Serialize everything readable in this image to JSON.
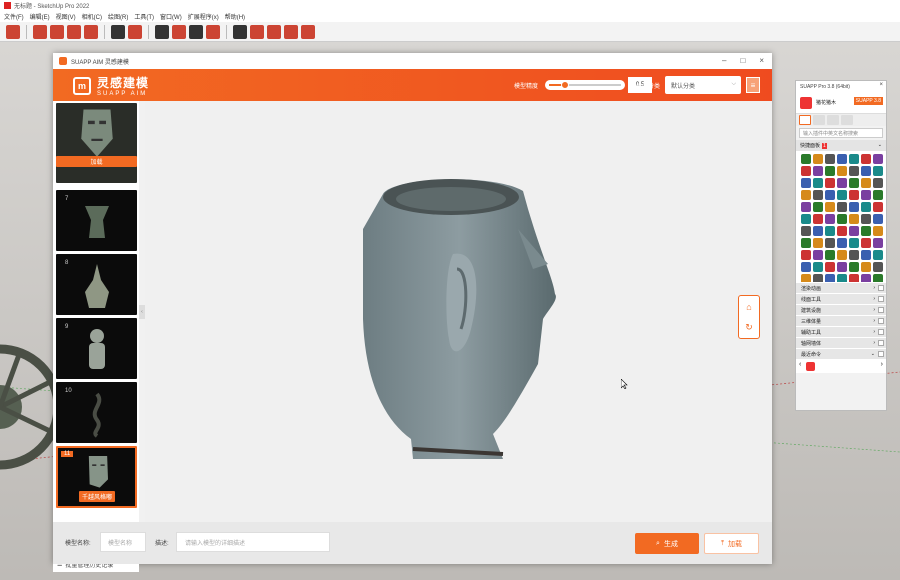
{
  "sketchup": {
    "title": "无标题 - SketchUp Pro 2022",
    "menus": [
      "文件(F)",
      "编辑(E)",
      "视图(V)",
      "相机(C)",
      "绘图(R)",
      "工具(T)",
      "窗口(W)",
      "扩展程序(x)",
      "帮助(H)"
    ]
  },
  "aim": {
    "window_title": "SUAPP AIM 灵感建模",
    "logo_cn": "灵感建模",
    "logo_en": "SUAPP AIM",
    "precision_label": "模型精度",
    "precision_value": "0.5",
    "precision_fraction": 0.5,
    "classify_label": "模型分类",
    "classify_value": "默认分类",
    "history": [
      {
        "num": "",
        "label": "加载",
        "active": false
      },
      {
        "num": "7",
        "label": "",
        "active": false
      },
      {
        "num": "8",
        "label": "",
        "active": false
      },
      {
        "num": "9",
        "label": "",
        "active": false
      },
      {
        "num": "10",
        "label": "",
        "active": false
      },
      {
        "num": "11",
        "label": "千越风格嘟",
        "active": true
      }
    ],
    "history_footer": "批量管理历史记录",
    "name_label": "模型名称:",
    "name_placeholder": "模型名称",
    "desc_label": "描述:",
    "desc_placeholder": "请输入模型的详细描述",
    "generate_label": "生成",
    "load_label": "加载"
  },
  "suapp": {
    "title": "SUAPP Pro 3.8 (64bit)",
    "username": "猪花猪木",
    "version": "SUAPP 3.8",
    "search_placeholder": "输入插件中英文名称搜索",
    "quick_label": "快捷面板",
    "quick_badge": "1",
    "categories": [
      "渲染动画",
      "线面工具",
      "建筑设施",
      "三维体量",
      "辅助工具",
      "轴网墙体",
      "最近命令"
    ]
  },
  "colors": {
    "accent": "#f26a22",
    "accent_dark": "#ef4b1f"
  }
}
